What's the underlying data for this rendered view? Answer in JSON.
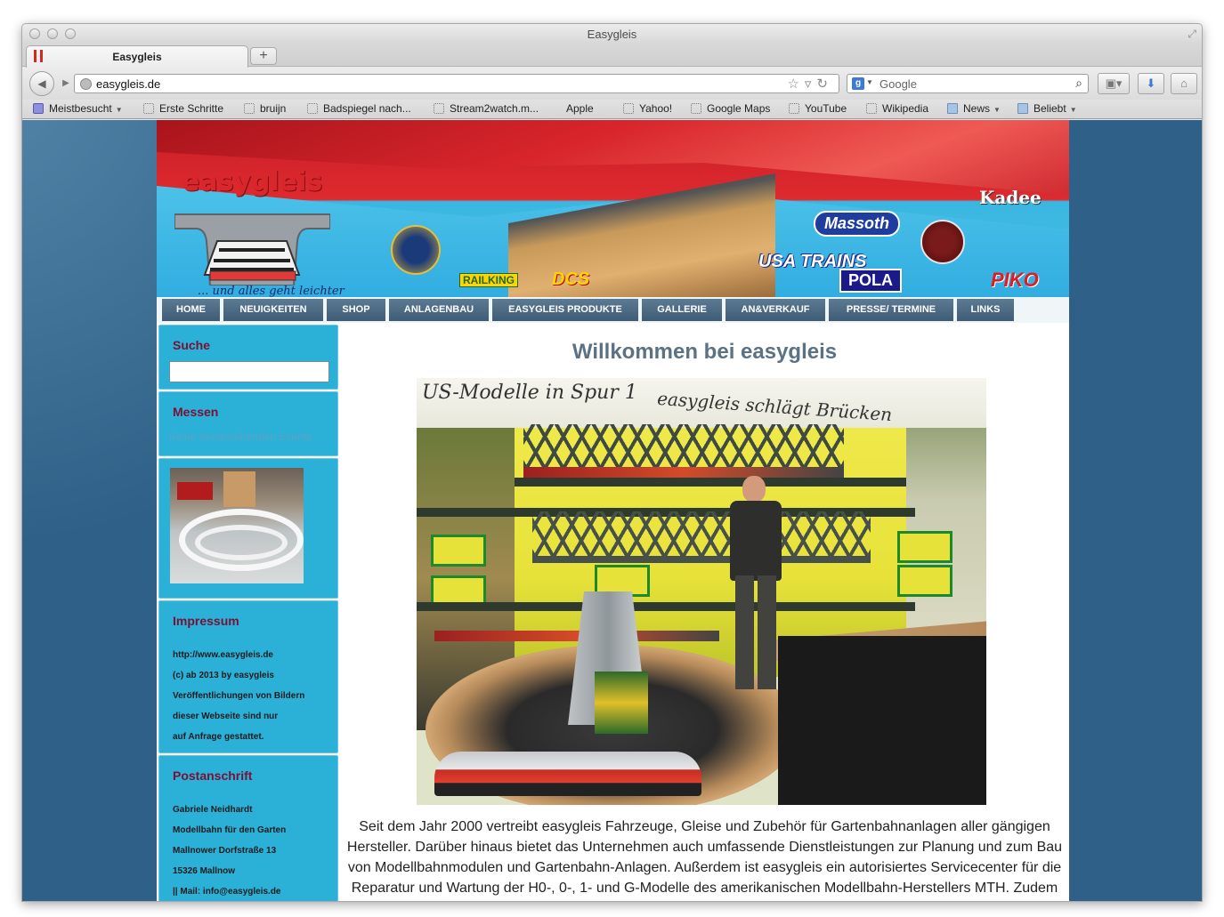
{
  "browser": {
    "window_title": "Easygleis",
    "tab_title": "Easygleis",
    "new_tab_symbol": "+",
    "url": "easygleis.de",
    "search_engine": "Google",
    "search_placeholder": "Google"
  },
  "bookmarks": [
    {
      "label": "Meistbesucht",
      "icon": "smart-folder-icon",
      "dropdown": true
    },
    {
      "label": "Erste Schritte",
      "icon": "page-icon"
    },
    {
      "label": "bruijn",
      "icon": "page-icon"
    },
    {
      "label": "Badspiegel nach...",
      "icon": "page-icon"
    },
    {
      "label": "Stream2watch.m...",
      "icon": "page-icon"
    },
    {
      "label": "Apple",
      "icon": "apple-icon"
    },
    {
      "label": "Yahoo!",
      "icon": "page-icon"
    },
    {
      "label": "Google Maps",
      "icon": "page-icon"
    },
    {
      "label": "YouTube",
      "icon": "page-icon"
    },
    {
      "label": "Wikipedia",
      "icon": "page-icon"
    },
    {
      "label": "News",
      "icon": "folder-icon",
      "dropdown": true
    },
    {
      "label": "Beliebt",
      "icon": "folder-icon",
      "dropdown": true
    }
  ],
  "banner": {
    "logo": "easygleis",
    "tagline": "... und alles geht leichter",
    "brands": [
      "Massoth",
      "Kadee",
      "POLA",
      "PIKO",
      "USA TRAINS",
      "RAILKING",
      "DCS"
    ]
  },
  "menu": [
    "HOME",
    "NEUIGKEITEN",
    "SHOP",
    "ANLAGENBAU",
    "EASYGLEIS PRODUKTE",
    "GALLERIE",
    "AN&VERKAUF",
    "PRESSE/ TERMINE",
    "LINKS"
  ],
  "sidebar": {
    "search_title": "Suche",
    "messen_title": "Messen",
    "no_events": "Keine bevorstehenden Events",
    "impressum_title": "Impressum",
    "impressum_lines": [
      "http://www.easygleis.de",
      "(c) ab 2013 by easygleis",
      "Veröffentlichungen von Bildern",
      "dieser Webseite sind nur",
      "auf Anfrage gestattet."
    ],
    "post_title": "Postanschrift",
    "post_lines": [
      "Gabriele Neidhardt",
      "Modellbahn für den Garten",
      "Mallnower Dorfstraße 13",
      "15326 Mallnow",
      "|| Mail: info@easygleis.de"
    ]
  },
  "main": {
    "title": "Willkommen bei easygleis",
    "photo_banner_left": "US-Modelle in Spur 1",
    "photo_banner_right": "easygleis schlägt Brücken",
    "body": "Seit dem Jahr 2000 vertreibt easygleis Fahrzeuge, Gleise und Zubehör für Gartenbahnanlagen aller gängigen Hersteller. Darüber hinaus bietet das Unternehmen auch umfassende Dienstleistungen zur Planung und zum Bau von Modellbahnmodulen und Gartenbahn-Anlagen. Außerdem ist easygleis ein autorisiertes Servicecenter für die Reparatur und Wartung der H0-, 0-, 1- und G-Modelle des amerikanischen Modellbahn-Herstellers MTH. Zudem"
  },
  "colors": {
    "page_bg": "#2f6188",
    "menu_item": "#4a6882",
    "sidebar_box": "#2bb1d8",
    "sidebar_title": "#7b1034",
    "welcome_title": "#5b7184"
  }
}
